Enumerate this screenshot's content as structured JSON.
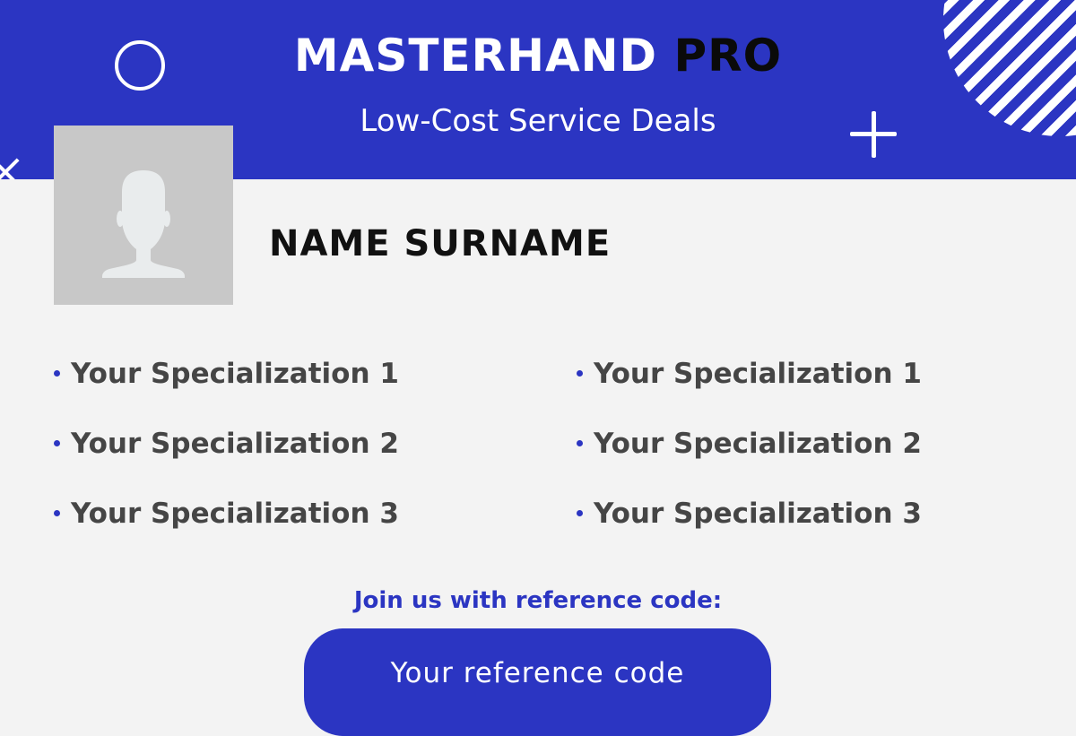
{
  "header": {
    "brand": "MASTERHAND",
    "brand_suffix": "PRO",
    "subtitle": "Low-Cost Service Deals"
  },
  "profile": {
    "avatar_icon": "person-silhouette-icon",
    "name": "NAME SURNAME"
  },
  "specializations": {
    "left": [
      "Your Specialization 1",
      "Your Specialization 2",
      "Your Specialization 3"
    ],
    "right": [
      "Your Specialization 1",
      "Your Specialization 2",
      "Your Specialization 3"
    ]
  },
  "reference": {
    "label": "Join us with reference code:",
    "code": "Your reference code"
  },
  "colors": {
    "primary": "#2b35c2",
    "background": "#f3f3f3",
    "avatar_bg": "#c8c8c8",
    "text_dark": "#111111",
    "text_muted": "#454545"
  },
  "decorations": [
    "ring-icon",
    "plus-icon",
    "striped-circle-icon",
    "close-icon"
  ]
}
